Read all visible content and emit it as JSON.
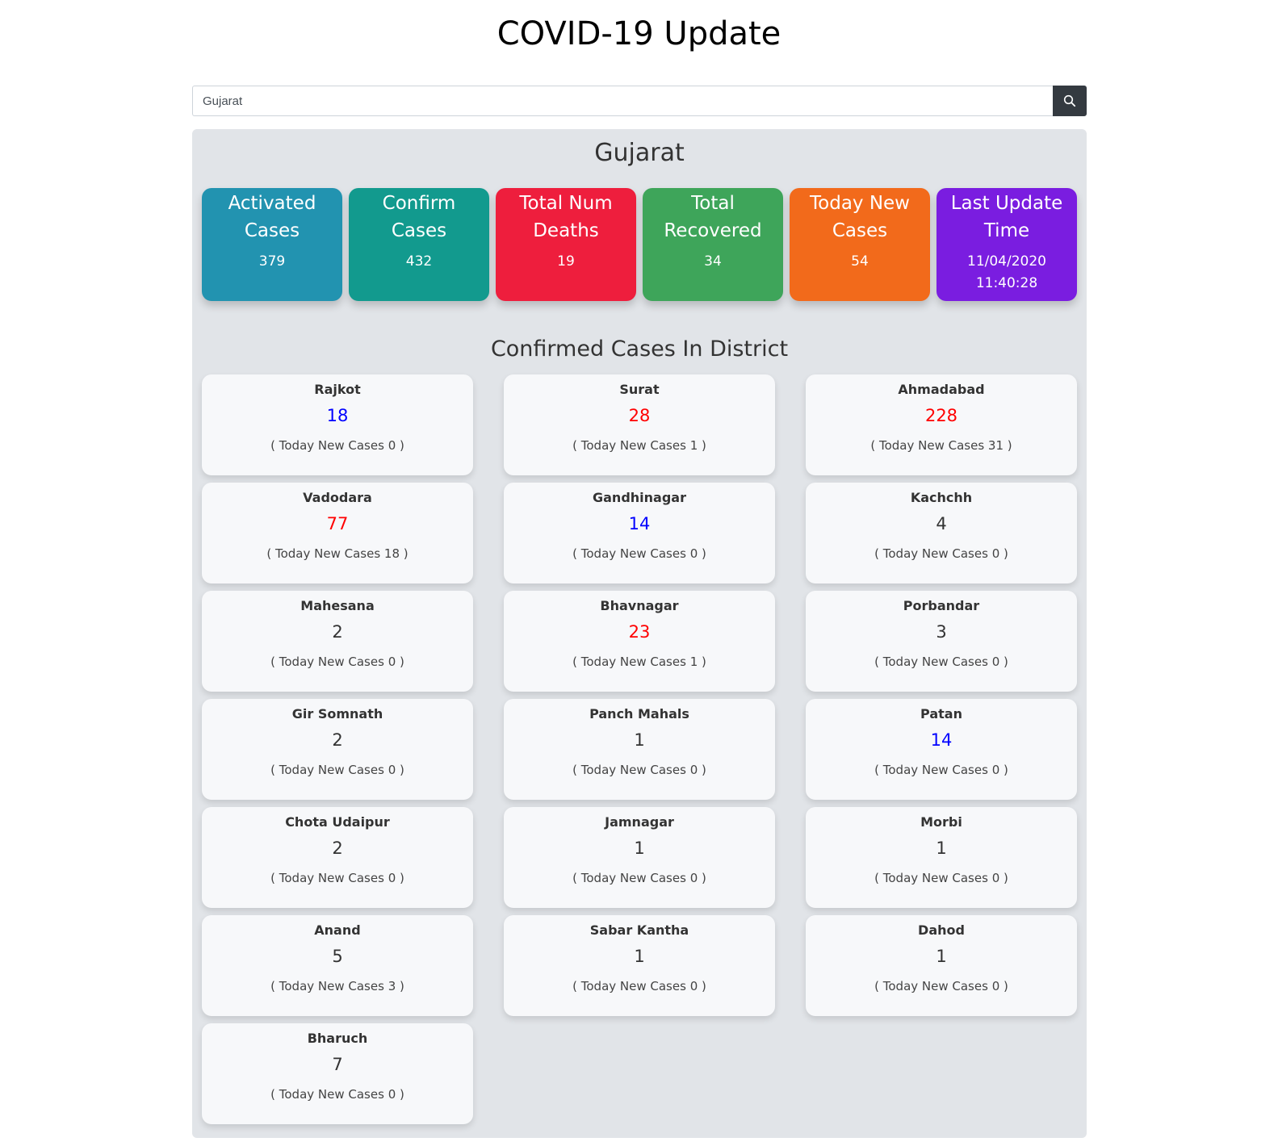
{
  "page_title": "COVID-19 Update",
  "search": {
    "value": "Gujarat",
    "button_icon": "search-icon"
  },
  "state": {
    "name": "Gujarat"
  },
  "stats": [
    {
      "label": "Activated Cases",
      "value": "379",
      "color": "#2293b0"
    },
    {
      "label": "Confirm Cases",
      "value": "432",
      "color": "#129a8e"
    },
    {
      "label": "Total Num Deaths",
      "value": "19",
      "color": "#ee1e3d"
    },
    {
      "label": "Total Recovered",
      "value": "34",
      "color": "#3ea55a"
    },
    {
      "label": "Today New Cases",
      "value": "54",
      "color": "#f26a1b"
    },
    {
      "label": "Last Update Time",
      "value": "11/04/2020 11:40:28",
      "color": "#7a1de0"
    }
  ],
  "districts_heading": "Confirmed Cases In District",
  "district_count_colors": {
    "red": "#ff0000",
    "blue": "#0000ff",
    "default": "#333333"
  },
  "districts": [
    {
      "name": "Rajkot",
      "count": "18",
      "color": "blue",
      "today_new": "( Today New Cases 0 )"
    },
    {
      "name": "Surat",
      "count": "28",
      "color": "red",
      "today_new": "( Today New Cases 1 )"
    },
    {
      "name": "Ahmadabad",
      "count": "228",
      "color": "red",
      "today_new": "( Today New Cases 31 )"
    },
    {
      "name": "Vadodara",
      "count": "77",
      "color": "red",
      "today_new": "( Today New Cases 18 )"
    },
    {
      "name": "Gandhinagar",
      "count": "14",
      "color": "blue",
      "today_new": "( Today New Cases 0 )"
    },
    {
      "name": "Kachchh",
      "count": "4",
      "color": "default",
      "today_new": "( Today New Cases 0 )"
    },
    {
      "name": "Mahesana",
      "count": "2",
      "color": "default",
      "today_new": "( Today New Cases 0 )"
    },
    {
      "name": "Bhavnagar",
      "count": "23",
      "color": "red",
      "today_new": "( Today New Cases 1 )"
    },
    {
      "name": "Porbandar",
      "count": "3",
      "color": "default",
      "today_new": "( Today New Cases 0 )"
    },
    {
      "name": "Gir Somnath",
      "count": "2",
      "color": "default",
      "today_new": "( Today New Cases 0 )"
    },
    {
      "name": "Panch Mahals",
      "count": "1",
      "color": "default",
      "today_new": "( Today New Cases 0 )"
    },
    {
      "name": "Patan",
      "count": "14",
      "color": "blue",
      "today_new": "( Today New Cases 0 )"
    },
    {
      "name": "Chota Udaipur",
      "count": "2",
      "color": "default",
      "today_new": "( Today New Cases 0 )"
    },
    {
      "name": "Jamnagar",
      "count": "1",
      "color": "default",
      "today_new": "( Today New Cases 0 )"
    },
    {
      "name": "Morbi",
      "count": "1",
      "color": "default",
      "today_new": "( Today New Cases 0 )"
    },
    {
      "name": "Anand",
      "count": "5",
      "color": "default",
      "today_new": "( Today New Cases 3 )"
    },
    {
      "name": "Sabar Kantha",
      "count": "1",
      "color": "default",
      "today_new": "( Today New Cases 0 )"
    },
    {
      "name": "Dahod",
      "count": "1",
      "color": "default",
      "today_new": "( Today New Cases 0 )"
    },
    {
      "name": "Bharuch",
      "count": "7",
      "color": "default",
      "today_new": "( Today New Cases 0 )"
    }
  ]
}
